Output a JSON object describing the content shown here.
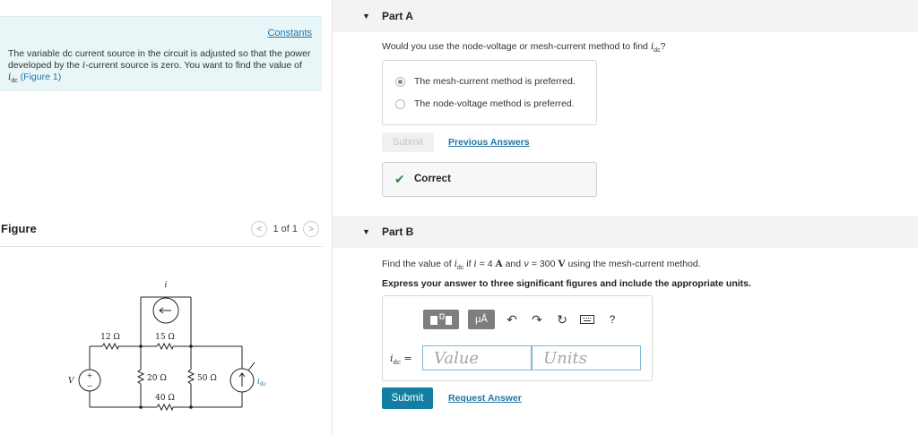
{
  "problem": {
    "constants_link": "Constants",
    "intro_1": "The variable dc current source in the circuit is adjusted so that the power developed by the ",
    "intro_var_i": "i",
    "intro_2": "-current source is zero. You want to find the value of ",
    "intro_var_idc": "i",
    "intro_sub": "dc",
    "intro_figure_link": "(Figure 1)"
  },
  "figure": {
    "title": "Figure",
    "pager_text": "1 of 1",
    "labels": {
      "r12": "12 Ω",
      "r15": "15 Ω",
      "r20": "20 Ω",
      "r50": "50 Ω",
      "r40": "40 Ω",
      "v": "V",
      "i": "i",
      "idc": "i",
      "idc_sub": "dc",
      "plus": "+",
      "minus": "−"
    }
  },
  "partA": {
    "label": "Part A",
    "question_1": "Would you use the node-voltage or mesh-current method to find ",
    "question_var": "i",
    "question_sub": "dc",
    "question_end": "?",
    "options": [
      {
        "label": "The mesh-current method is preferred.",
        "selected": true
      },
      {
        "label": "The node-voltage method is preferred.",
        "selected": false
      }
    ],
    "submit_label": "Submit",
    "previous_answers": "Previous Answers",
    "result": "Correct"
  },
  "partB": {
    "label": "Part B",
    "q_1": "Find the value of ",
    "q_var_idc": "i",
    "q_sub": "dc",
    "q_2": " if ",
    "q_var_i": "i",
    "q_3": " = 4 ",
    "q_unit_a": "A",
    "q_4": " and ",
    "q_var_v": "v",
    "q_5": " = 300 ",
    "q_unit_v": "V",
    "q_6": " using the mesh-current method.",
    "instruction": "Express your answer to three significant figures and include the appropriate units.",
    "toolbar": {
      "units_button": "μÅ",
      "help": "?"
    },
    "eq_var": "i",
    "eq_sub": "dc",
    "eq_sign": " =",
    "value_placeholder": "Value",
    "units_placeholder": "Units",
    "submit_label": "Submit",
    "request_answer": "Request Answer"
  },
  "colors": {
    "accent": "#127fa2",
    "link": "#2474a4",
    "intro_bg": "#e8f6f8",
    "correct": "#2e8b3a"
  }
}
